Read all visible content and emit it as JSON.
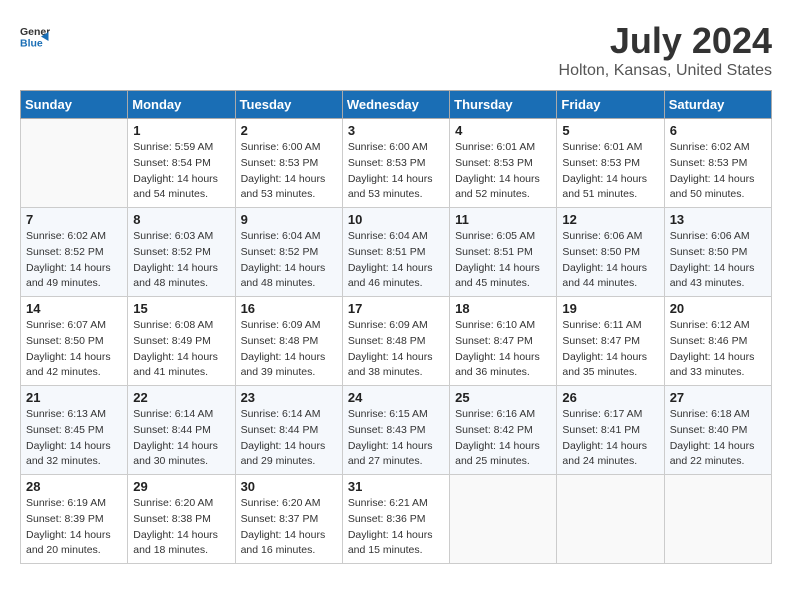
{
  "logo": {
    "general": "General",
    "blue": "Blue"
  },
  "title": "July 2024",
  "subtitle": "Holton, Kansas, United States",
  "weekdays": [
    "Sunday",
    "Monday",
    "Tuesday",
    "Wednesday",
    "Thursday",
    "Friday",
    "Saturday"
  ],
  "weeks": [
    [
      {
        "day": "",
        "sunrise": "",
        "sunset": "",
        "daylight": ""
      },
      {
        "day": "1",
        "sunrise": "Sunrise: 5:59 AM",
        "sunset": "Sunset: 8:54 PM",
        "daylight": "Daylight: 14 hours and 54 minutes."
      },
      {
        "day": "2",
        "sunrise": "Sunrise: 6:00 AM",
        "sunset": "Sunset: 8:53 PM",
        "daylight": "Daylight: 14 hours and 53 minutes."
      },
      {
        "day": "3",
        "sunrise": "Sunrise: 6:00 AM",
        "sunset": "Sunset: 8:53 PM",
        "daylight": "Daylight: 14 hours and 53 minutes."
      },
      {
        "day": "4",
        "sunrise": "Sunrise: 6:01 AM",
        "sunset": "Sunset: 8:53 PM",
        "daylight": "Daylight: 14 hours and 52 minutes."
      },
      {
        "day": "5",
        "sunrise": "Sunrise: 6:01 AM",
        "sunset": "Sunset: 8:53 PM",
        "daylight": "Daylight: 14 hours and 51 minutes."
      },
      {
        "day": "6",
        "sunrise": "Sunrise: 6:02 AM",
        "sunset": "Sunset: 8:53 PM",
        "daylight": "Daylight: 14 hours and 50 minutes."
      }
    ],
    [
      {
        "day": "7",
        "sunrise": "Sunrise: 6:02 AM",
        "sunset": "Sunset: 8:52 PM",
        "daylight": "Daylight: 14 hours and 49 minutes."
      },
      {
        "day": "8",
        "sunrise": "Sunrise: 6:03 AM",
        "sunset": "Sunset: 8:52 PM",
        "daylight": "Daylight: 14 hours and 48 minutes."
      },
      {
        "day": "9",
        "sunrise": "Sunrise: 6:04 AM",
        "sunset": "Sunset: 8:52 PM",
        "daylight": "Daylight: 14 hours and 48 minutes."
      },
      {
        "day": "10",
        "sunrise": "Sunrise: 6:04 AM",
        "sunset": "Sunset: 8:51 PM",
        "daylight": "Daylight: 14 hours and 46 minutes."
      },
      {
        "day": "11",
        "sunrise": "Sunrise: 6:05 AM",
        "sunset": "Sunset: 8:51 PM",
        "daylight": "Daylight: 14 hours and 45 minutes."
      },
      {
        "day": "12",
        "sunrise": "Sunrise: 6:06 AM",
        "sunset": "Sunset: 8:50 PM",
        "daylight": "Daylight: 14 hours and 44 minutes."
      },
      {
        "day": "13",
        "sunrise": "Sunrise: 6:06 AM",
        "sunset": "Sunset: 8:50 PM",
        "daylight": "Daylight: 14 hours and 43 minutes."
      }
    ],
    [
      {
        "day": "14",
        "sunrise": "Sunrise: 6:07 AM",
        "sunset": "Sunset: 8:50 PM",
        "daylight": "Daylight: 14 hours and 42 minutes."
      },
      {
        "day": "15",
        "sunrise": "Sunrise: 6:08 AM",
        "sunset": "Sunset: 8:49 PM",
        "daylight": "Daylight: 14 hours and 41 minutes."
      },
      {
        "day": "16",
        "sunrise": "Sunrise: 6:09 AM",
        "sunset": "Sunset: 8:48 PM",
        "daylight": "Daylight: 14 hours and 39 minutes."
      },
      {
        "day": "17",
        "sunrise": "Sunrise: 6:09 AM",
        "sunset": "Sunset: 8:48 PM",
        "daylight": "Daylight: 14 hours and 38 minutes."
      },
      {
        "day": "18",
        "sunrise": "Sunrise: 6:10 AM",
        "sunset": "Sunset: 8:47 PM",
        "daylight": "Daylight: 14 hours and 36 minutes."
      },
      {
        "day": "19",
        "sunrise": "Sunrise: 6:11 AM",
        "sunset": "Sunset: 8:47 PM",
        "daylight": "Daylight: 14 hours and 35 minutes."
      },
      {
        "day": "20",
        "sunrise": "Sunrise: 6:12 AM",
        "sunset": "Sunset: 8:46 PM",
        "daylight": "Daylight: 14 hours and 33 minutes."
      }
    ],
    [
      {
        "day": "21",
        "sunrise": "Sunrise: 6:13 AM",
        "sunset": "Sunset: 8:45 PM",
        "daylight": "Daylight: 14 hours and 32 minutes."
      },
      {
        "day": "22",
        "sunrise": "Sunrise: 6:14 AM",
        "sunset": "Sunset: 8:44 PM",
        "daylight": "Daylight: 14 hours and 30 minutes."
      },
      {
        "day": "23",
        "sunrise": "Sunrise: 6:14 AM",
        "sunset": "Sunset: 8:44 PM",
        "daylight": "Daylight: 14 hours and 29 minutes."
      },
      {
        "day": "24",
        "sunrise": "Sunrise: 6:15 AM",
        "sunset": "Sunset: 8:43 PM",
        "daylight": "Daylight: 14 hours and 27 minutes."
      },
      {
        "day": "25",
        "sunrise": "Sunrise: 6:16 AM",
        "sunset": "Sunset: 8:42 PM",
        "daylight": "Daylight: 14 hours and 25 minutes."
      },
      {
        "day": "26",
        "sunrise": "Sunrise: 6:17 AM",
        "sunset": "Sunset: 8:41 PM",
        "daylight": "Daylight: 14 hours and 24 minutes."
      },
      {
        "day": "27",
        "sunrise": "Sunrise: 6:18 AM",
        "sunset": "Sunset: 8:40 PM",
        "daylight": "Daylight: 14 hours and 22 minutes."
      }
    ],
    [
      {
        "day": "28",
        "sunrise": "Sunrise: 6:19 AM",
        "sunset": "Sunset: 8:39 PM",
        "daylight": "Daylight: 14 hours and 20 minutes."
      },
      {
        "day": "29",
        "sunrise": "Sunrise: 6:20 AM",
        "sunset": "Sunset: 8:38 PM",
        "daylight": "Daylight: 14 hours and 18 minutes."
      },
      {
        "day": "30",
        "sunrise": "Sunrise: 6:20 AM",
        "sunset": "Sunset: 8:37 PM",
        "daylight": "Daylight: 14 hours and 16 minutes."
      },
      {
        "day": "31",
        "sunrise": "Sunrise: 6:21 AM",
        "sunset": "Sunset: 8:36 PM",
        "daylight": "Daylight: 14 hours and 15 minutes."
      },
      {
        "day": "",
        "sunrise": "",
        "sunset": "",
        "daylight": ""
      },
      {
        "day": "",
        "sunrise": "",
        "sunset": "",
        "daylight": ""
      },
      {
        "day": "",
        "sunrise": "",
        "sunset": "",
        "daylight": ""
      }
    ]
  ]
}
